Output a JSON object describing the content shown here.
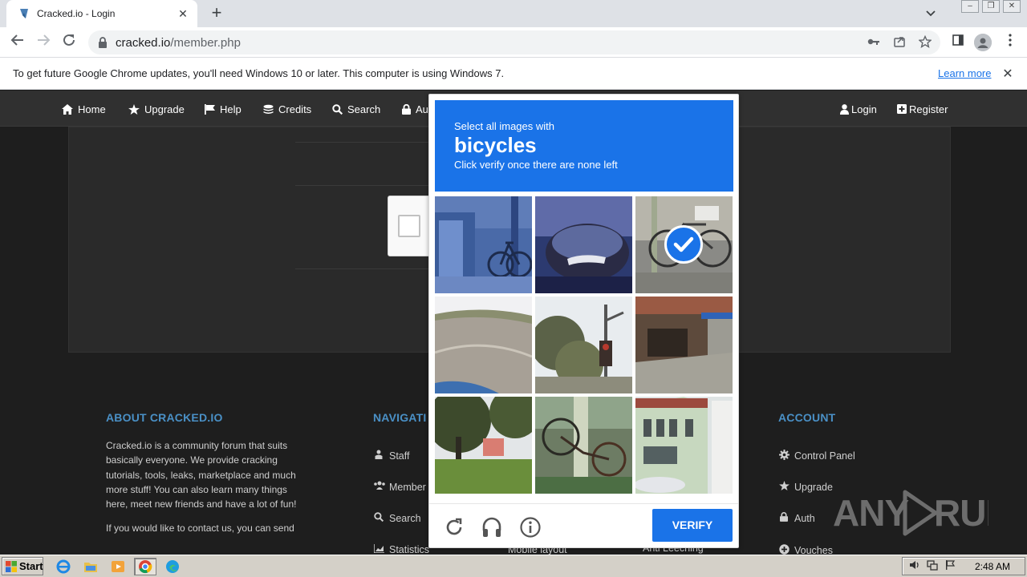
{
  "browser": {
    "tab_title": "Cracked.io - Login",
    "url_host": "cracked.io",
    "url_path": "/member.php",
    "infobar_message": "To get future Google Chrome updates, you'll need Windows 10 or later. This computer is using Windows 7.",
    "infobar_link": "Learn more"
  },
  "site_nav": {
    "items": [
      {
        "label": "Home",
        "icon": "home-icon"
      },
      {
        "label": "Upgrade",
        "icon": "star-icon"
      },
      {
        "label": "Help",
        "icon": "flag-icon"
      },
      {
        "label": "Credits",
        "icon": "coins-icon"
      },
      {
        "label": "Search",
        "icon": "search-icon"
      },
      {
        "label": "Au",
        "icon": "lock-icon"
      }
    ],
    "right": [
      {
        "label": "Login",
        "icon": "user-icon"
      },
      {
        "label": "Register",
        "icon": "plus-square-icon"
      }
    ]
  },
  "footer": {
    "about_title": "ABOUT CRACKED.IO",
    "about_text": "Cracked.io is a community forum that suits basically everyone. We provide cracking tutorials, tools, leaks, marketplace and much more stuff! You can also learn many things here, meet new friends and have a lot of fun!",
    "about_text2": "If you would like to contact us, you can send",
    "nav_title": "NAVIGATI",
    "nav_links": [
      {
        "label": "Staff",
        "icon": "users-icon"
      },
      {
        "label": "Member",
        "icon": "users-icon"
      },
      {
        "label": "Search",
        "icon": "search-icon"
      },
      {
        "label": "Statistics",
        "icon": "chart-icon"
      }
    ],
    "hidden_links": [
      "Mobile layout",
      "Anti Leeching"
    ],
    "account_title": "ACCOUNT",
    "account_links": [
      {
        "label": "Control Panel",
        "icon": "gear-icon"
      },
      {
        "label": "Upgrade",
        "icon": "star-icon"
      },
      {
        "label": "Auth",
        "icon": "lock-icon"
      },
      {
        "label": "Vouches",
        "icon": "plus-circle-icon"
      }
    ]
  },
  "captcha": {
    "prompt_line1": "Select all images with",
    "prompt_subject": "bicycles",
    "prompt_line3": "Click verify once there are none left",
    "verify_label": "VERIFY",
    "tiles": [
      {
        "id": 1,
        "subject": "bicycle-on-street",
        "selected": false
      },
      {
        "id": 2,
        "subject": "car-mirror",
        "selected": false
      },
      {
        "id": 3,
        "subject": "bicycle-on-pole",
        "selected": true
      },
      {
        "id": 4,
        "subject": "road-curve",
        "selected": false
      },
      {
        "id": 5,
        "subject": "traffic-light",
        "selected": false
      },
      {
        "id": 6,
        "subject": "storefront-street",
        "selected": false
      },
      {
        "id": 7,
        "subject": "park-trees",
        "selected": false
      },
      {
        "id": 8,
        "subject": "bicycle-upside-down",
        "selected": false
      },
      {
        "id": 9,
        "subject": "victorian-house",
        "selected": false
      }
    ]
  },
  "watermark": "ANY RUN",
  "taskbar": {
    "start_label": "Start",
    "clock": "2:48 AM"
  }
}
